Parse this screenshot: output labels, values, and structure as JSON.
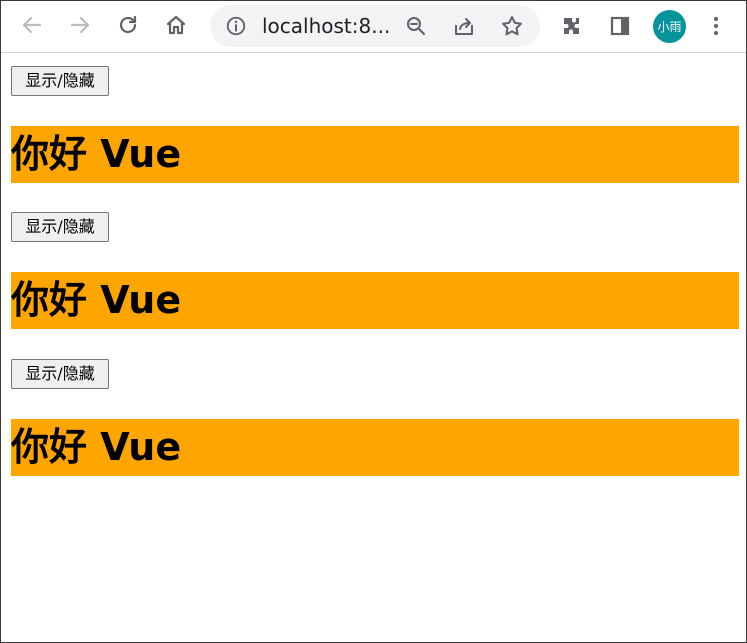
{
  "browser": {
    "url": "localhost:8...",
    "profile_label": "小雨",
    "icons": {
      "back": "back-arrow-icon",
      "forward": "forward-arrow-icon",
      "reload": "reload-icon",
      "home": "home-icon",
      "info": "info-icon",
      "zoom": "zoom-out-icon",
      "share": "share-icon",
      "star": "star-icon",
      "extensions": "puzzle-icon",
      "side_panel": "side-panel-icon",
      "menu": "kebab-menu-icon"
    }
  },
  "page": {
    "sections": [
      {
        "button_label": "显示/隐藏",
        "heading": "你好 Vue"
      },
      {
        "button_label": "显示/隐藏",
        "heading": "你好 Vue"
      },
      {
        "button_label": "显示/隐藏",
        "heading": "你好 Vue"
      }
    ]
  },
  "colors": {
    "heading_background": "#ffa500",
    "profile_background": "#07939b",
    "omnibox_background": "#f1f3f4"
  }
}
